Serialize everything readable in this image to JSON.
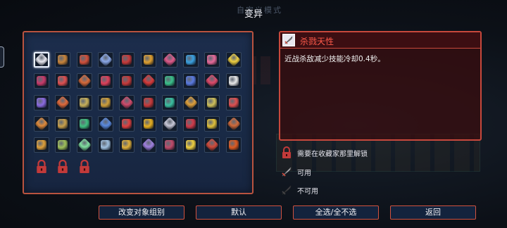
{
  "title": "变异",
  "title_ghost": "自定义模式",
  "detail": {
    "name": "杀戮天性",
    "description": "近战杀敌减少技能冷却0.4秒。"
  },
  "legend": [
    {
      "icon": "lock-icon",
      "label": "需要在收藏家那里解锁"
    },
    {
      "icon": "sword-icon",
      "label": "可用"
    },
    {
      "icon": "sword-disabled-icon",
      "label": "不可用"
    }
  ],
  "buttons": [
    {
      "id": "change-target-group",
      "label": "改变对象组别"
    },
    {
      "id": "default",
      "label": "默认"
    },
    {
      "id": "select-all",
      "label": "全选/全不选"
    },
    {
      "id": "back",
      "label": "返回"
    }
  ],
  "grid": {
    "rows": [
      [
        "#e8e8f0",
        "#c8843a",
        "#d2503a",
        "#8aa8e8",
        "#c83a3a",
        "#e0a030",
        "#e05a8a",
        "#3aa0e0",
        "#e86a9a",
        "#f0d040"
      ],
      [
        "#c83a6a",
        "#e05050",
        "#d86a3a",
        "#e0405a",
        "#c83a3a",
        "#d83a3a",
        "#3ac08a",
        "#5a7ae0",
        "#e04a6a",
        "#e8e8e8"
      ],
      [
        "#8a6ae0",
        "#e06a3a",
        "#c8b05a",
        "#d0a03a",
        "#d04a6a",
        "#c83a3a",
        "#3ac0a0",
        "#e0a03a",
        "#d0c05a",
        "#e05050"
      ],
      [
        "#e08a3a",
        "#c8a04a",
        "#40c080",
        "#5a8ae0",
        "#e04040",
        "#e8b020",
        "#c8c8d8",
        "#d03a4a",
        "#e0c03a",
        "#d06a3a"
      ],
      [
        "#e0a03a",
        "#a0c05a",
        "#80e0a0",
        "#a0c0e0",
        "#e0b03a",
        "#a080e0",
        "#c04a6a",
        "#f0d040",
        "#d04a3a",
        "#e05a20"
      ]
    ],
    "locked_count": 3
  },
  "colors": {
    "accent": "#c8483c",
    "panel": "#1c2d4c",
    "detail_title": "#ff5a4a"
  }
}
